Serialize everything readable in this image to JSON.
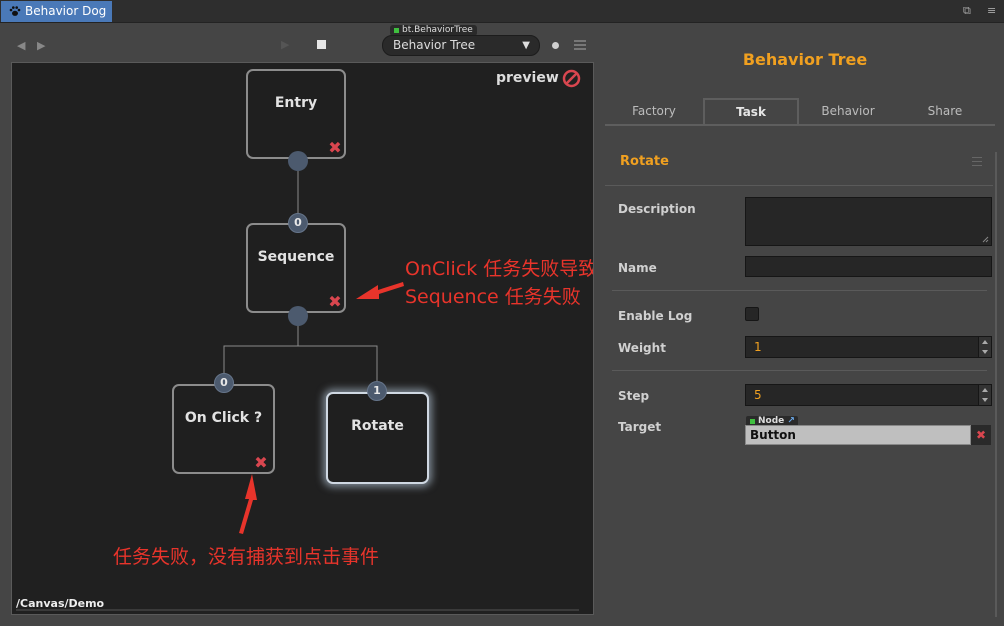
{
  "window": {
    "tab_title": "Behavior Dog"
  },
  "toolbar": {
    "tree_tag": "bt.BehaviorTree",
    "tree_select_value": "Behavior Tree"
  },
  "canvas": {
    "preview_label": "preview",
    "path": "/Canvas/Demo",
    "nodes": [
      {
        "label": "Entry"
      },
      {
        "label": "Sequence",
        "port_index": "0"
      },
      {
        "label": "On Click ?",
        "port_index": "0"
      },
      {
        "label": "Rotate",
        "port_index": "1"
      }
    ],
    "annotations": {
      "sequence_note_line1": "OnClick 任务失败导致",
      "sequence_note_line2": "Sequence 任务失败",
      "onclick_note": "任务失败，没有捕获到点击事件"
    }
  },
  "panel": {
    "title": "Behavior Tree",
    "tabs": [
      "Factory",
      "Task",
      "Behavior",
      "Share"
    ],
    "selected_tab": "Task",
    "section_title": "Rotate",
    "props": {
      "description_label": "Description",
      "description_value": "",
      "name_label": "Name",
      "name_value": "",
      "enable_log_label": "Enable Log",
      "weight_label": "Weight",
      "weight_value": "1",
      "step_label": "Step",
      "step_value": "5",
      "target_label": "Target",
      "target_tag": "Node",
      "target_value": "Button"
    }
  },
  "colors": {
    "accent": "#f0a020",
    "fail": "#d9464f",
    "annotation": "#e8342b",
    "tab_blue": "#4a79b8"
  }
}
